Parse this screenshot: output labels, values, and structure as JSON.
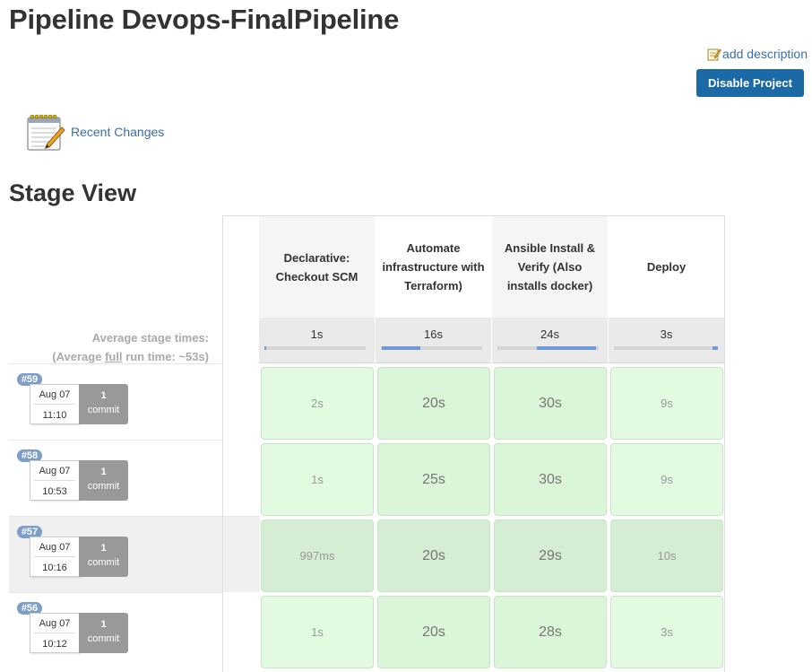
{
  "page_title": "Pipeline Devops-FinalPipeline",
  "add_description": "add description",
  "disable_button": "Disable Project",
  "recent_changes": "Recent Changes",
  "stage_view_title": "Stage View",
  "average_label": {
    "line1": "Average stage times:",
    "line2_prefix": "(Average ",
    "line2_full": "full",
    "line2_suffix": " run time: ~53s)"
  },
  "stages": [
    {
      "name": "Declarative: Checkout SCM",
      "avg": "1s",
      "avg_fraction": 0.01
    },
    {
      "name": "Automate infrastructure with Terraform)",
      "avg": "16s",
      "avg_fraction": 0.38
    },
    {
      "name": "Ansible Install & Verify (Also installs docker)",
      "avg": "24s",
      "avg_fraction": 0.58
    },
    {
      "name": "Deploy",
      "avg": "3s",
      "avg_fraction": 0.06
    }
  ],
  "builds": [
    {
      "id": "#59",
      "date": "Aug 07",
      "time": "11:10",
      "commits": "1",
      "commit_label": "commit",
      "durations": [
        "2s",
        "20s",
        "30s",
        "9s"
      ]
    },
    {
      "id": "#58",
      "date": "Aug 07",
      "time": "10:53",
      "commits": "1",
      "commit_label": "commit",
      "durations": [
        "1s",
        "25s",
        "30s",
        "9s"
      ]
    },
    {
      "id": "#57",
      "date": "Aug 07",
      "time": "10:16",
      "commits": "1",
      "commit_label": "commit",
      "durations": [
        "997ms",
        "20s",
        "29s",
        "10s"
      ]
    },
    {
      "id": "#56",
      "date": "Aug 07",
      "time": "10:12",
      "commits": "1",
      "commit_label": "commit",
      "durations": [
        "1s",
        "20s",
        "28s",
        "3s"
      ]
    }
  ],
  "colors": {
    "button_blue": "#1b6aa5",
    "link_blue": "#3a6ea5",
    "cell_green": "#e2fbe0",
    "badge_blue": "#7c9ec9",
    "commit_gray": "#999999"
  }
}
